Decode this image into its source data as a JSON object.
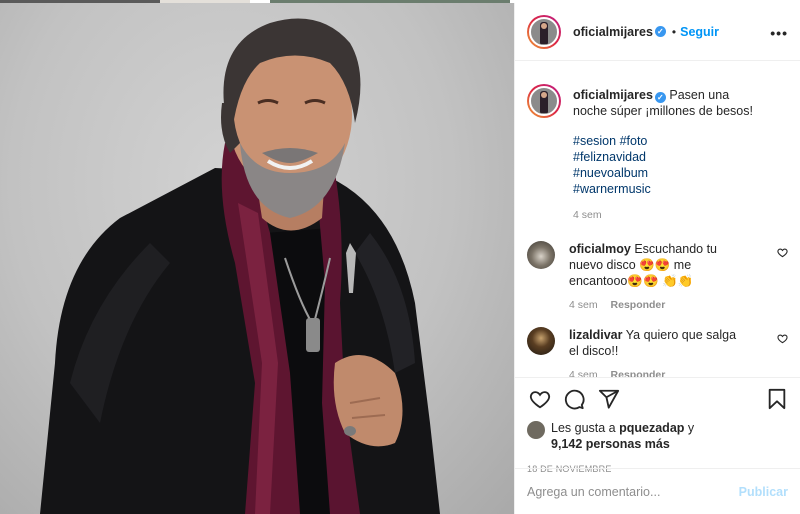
{
  "header": {
    "username": "oficialmijares",
    "separator": "•",
    "follow_label": "Seguir",
    "more_label": "•••"
  },
  "caption": {
    "username": "oficialmijares",
    "text": "Pasen una noche súper ¡millones de besos!",
    "hashtags": [
      "#sesion",
      "#foto",
      "#feliznavidad",
      "#nuevoalbum",
      "#warnermusic"
    ],
    "time": "4 sem"
  },
  "comments": [
    {
      "username": "oficialmoy",
      "text": "Escuchando tu nuevo disco 😍😍 me encantooo😍😍 👏👏",
      "time": "4 sem",
      "reply_label": "Responder"
    },
    {
      "username": "lizaldivar",
      "text": "Ya quiero que salga el disco!!",
      "time": "4 sem",
      "reply_label": "Responder"
    }
  ],
  "likes": {
    "prefix": "Les gusta a",
    "user": "pquezadap",
    "connector": "y",
    "count_text": "9,142 personas más"
  },
  "date": "18 DE NOVIEMBRE",
  "add_comment": {
    "placeholder": "Agrega un comentario...",
    "publish_label": "Publicar"
  },
  "icons": {
    "like": "heart-icon",
    "comment": "comment-icon",
    "share": "send-icon",
    "save": "bookmark-icon"
  },
  "colors": {
    "link": "#0095f6",
    "hashtag": "#00376b",
    "muted": "#8e8e8e",
    "publish_disabled": "#b2dffc"
  }
}
